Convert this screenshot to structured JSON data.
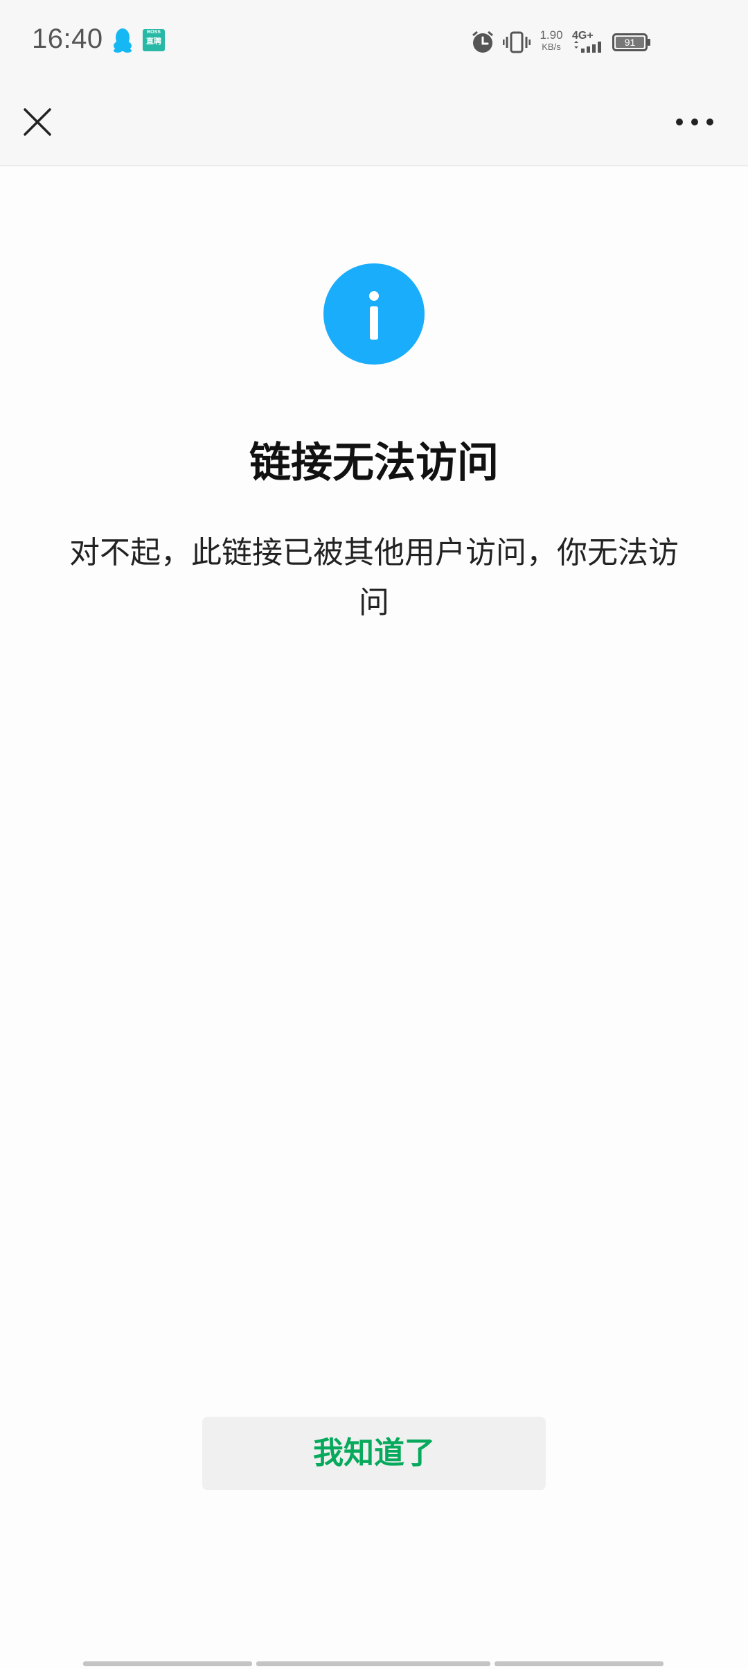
{
  "status_bar": {
    "time": "16:40",
    "boss_app_icon_text_top": "BOSS",
    "boss_app_icon_text_bottom": "直聘",
    "network_speed_value": "1.90",
    "network_speed_unit": "KB/s",
    "network_type": "4G+",
    "battery_level": "91"
  },
  "nav": {
    "close_icon": "close-icon",
    "more_icon": "more-dots-icon"
  },
  "main": {
    "icon": "info-icon",
    "icon_color": "#1aadfb",
    "title": "链接无法访问",
    "message": "对不起，此链接已被其他用户访问，你无法访问"
  },
  "actions": {
    "ack_label": "我知道了",
    "ack_color": "#07a95c"
  }
}
